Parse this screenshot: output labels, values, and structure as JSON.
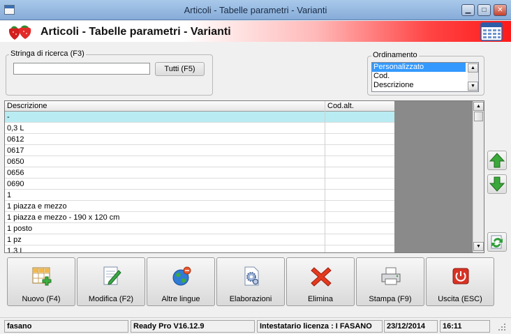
{
  "window": {
    "title": "Articoli - Tabelle parametri - Varianti",
    "minimize": "▁",
    "maximize": "□",
    "close": "✕"
  },
  "header": {
    "title": "Articoli - Tabelle parametri - Varianti"
  },
  "search": {
    "legend": "Stringa di ricerca (F3)",
    "value": "",
    "all_button": "Tutti (F5)"
  },
  "sort": {
    "legend": "Ordinamento",
    "options": [
      "Personalizzato",
      "Cod.",
      "Descrizione"
    ],
    "selected": "Personalizzato"
  },
  "grid": {
    "columns": [
      "Descrizione",
      "Cod.alt."
    ],
    "rows": [
      {
        "descrizione": "-",
        "cod_alt": ""
      },
      {
        "descrizione": "0,3 L",
        "cod_alt": ""
      },
      {
        "descrizione": "0612",
        "cod_alt": ""
      },
      {
        "descrizione": "0617",
        "cod_alt": ""
      },
      {
        "descrizione": "0650",
        "cod_alt": ""
      },
      {
        "descrizione": "0656",
        "cod_alt": ""
      },
      {
        "descrizione": "0690",
        "cod_alt": ""
      },
      {
        "descrizione": "1",
        "cod_alt": ""
      },
      {
        "descrizione": "1 piazza e mezzo",
        "cod_alt": ""
      },
      {
        "descrizione": "1 piazza e mezzo - 190 x 120 cm",
        "cod_alt": ""
      },
      {
        "descrizione": "1 posto",
        "cod_alt": ""
      },
      {
        "descrizione": "1 pz",
        "cod_alt": ""
      },
      {
        "descrizione": "1,3 L",
        "cod_alt": ""
      }
    ],
    "selected_row": 0
  },
  "toolbar": {
    "nuovo": "Nuovo (F4)",
    "modifica": "Modifica (F2)",
    "altre_lingue": "Altre lingue",
    "elaborazioni": "Elaborazioni",
    "elimina": "Elimina",
    "stampa": "Stampa (F9)",
    "uscita": "Uscita (ESC)"
  },
  "status": {
    "user": "fasano",
    "version": "Ready Pro V16.12.9",
    "license": "Intestatario licenza : I FASANO",
    "date": "23/12/2014",
    "time": "16:11"
  },
  "icons": {
    "app": "window-icon",
    "logo": "strawberry-icon",
    "calendar": "calendar-icon",
    "move_up": "arrow-up-icon",
    "move_down": "arrow-down-icon",
    "refresh": "refresh-icon"
  },
  "colors": {
    "header_gradient_end": "#ff1a1a",
    "selected_row": "#b8ecf2",
    "list_selection": "#3399ff",
    "grid_empty_area": "#8a8a8a"
  }
}
